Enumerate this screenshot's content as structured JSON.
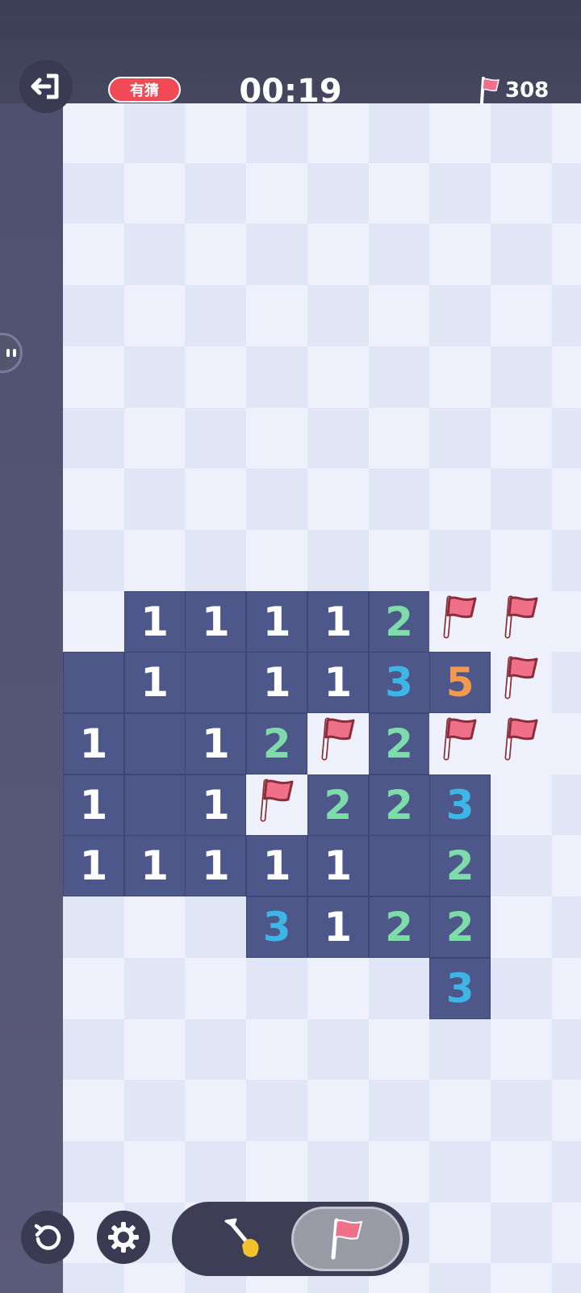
{
  "header": {
    "guess_badge": "有猜",
    "timer": "00:19",
    "flags_remaining": "308"
  },
  "icons": {
    "exit": "exit-icon",
    "flag": "flag-icon",
    "undo": "undo-icon",
    "settings": "gear-icon",
    "dig": "shovel-icon"
  },
  "colors": {
    "open_cell": "#4d5789",
    "number_1": "#ffffff",
    "number_2": "#7edcaa",
    "number_3": "#3db6e6",
    "number_5": "#f19a4d",
    "flag": "#f0708a",
    "badge": "#ef4a55"
  },
  "board": {
    "columns": 9,
    "visible_rows": 20,
    "cells": [
      [
        0,
        9,
        "o",
        ""
      ],
      [
        0,
        10,
        "o",
        "1"
      ],
      [
        0,
        11,
        "o",
        "1"
      ],
      [
        0,
        12,
        "o",
        "1"
      ],
      [
        1,
        8,
        "o",
        "1"
      ],
      [
        1,
        9,
        "o",
        "1"
      ],
      [
        1,
        10,
        "o",
        ""
      ],
      [
        1,
        11,
        "o",
        ""
      ],
      [
        1,
        12,
        "o",
        "1"
      ],
      [
        2,
        8,
        "o",
        "1"
      ],
      [
        2,
        9,
        "o",
        ""
      ],
      [
        2,
        10,
        "o",
        "1"
      ],
      [
        2,
        11,
        "o",
        "1"
      ],
      [
        2,
        12,
        "o",
        "1"
      ],
      [
        3,
        8,
        "o",
        "1"
      ],
      [
        3,
        9,
        "o",
        "1"
      ],
      [
        3,
        10,
        "o",
        "2"
      ],
      [
        3,
        11,
        "f",
        ""
      ],
      [
        3,
        12,
        "o",
        "1"
      ],
      [
        3,
        13,
        "o",
        "3"
      ],
      [
        4,
        8,
        "o",
        "1"
      ],
      [
        4,
        9,
        "o",
        "1"
      ],
      [
        4,
        10,
        "f",
        ""
      ],
      [
        4,
        11,
        "o",
        "2"
      ],
      [
        4,
        12,
        "o",
        "1"
      ],
      [
        4,
        13,
        "o",
        "1"
      ],
      [
        5,
        8,
        "o",
        "2"
      ],
      [
        5,
        9,
        "o",
        "3"
      ],
      [
        5,
        10,
        "o",
        "2"
      ],
      [
        5,
        11,
        "o",
        "2"
      ],
      [
        5,
        12,
        "o",
        ""
      ],
      [
        5,
        13,
        "o",
        "2"
      ],
      [
        6,
        8,
        "f",
        ""
      ],
      [
        6,
        9,
        "o",
        "5"
      ],
      [
        6,
        10,
        "f",
        ""
      ],
      [
        6,
        11,
        "o",
        "3"
      ],
      [
        6,
        12,
        "o",
        "2"
      ],
      [
        6,
        13,
        "o",
        "2"
      ],
      [
        6,
        14,
        "o",
        "3"
      ],
      [
        7,
        8,
        "f",
        ""
      ],
      [
        7,
        9,
        "f",
        ""
      ],
      [
        7,
        10,
        "f",
        ""
      ]
    ]
  }
}
